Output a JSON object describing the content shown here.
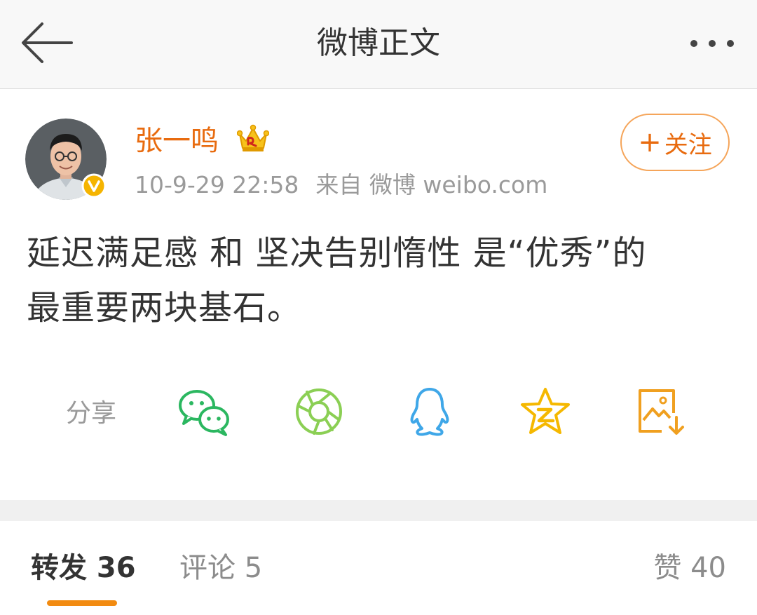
{
  "header": {
    "title": "微博正文",
    "back_icon": "arrow-left-icon",
    "more_icon": "more-dots-icon"
  },
  "post": {
    "author": "张一鸣",
    "author_badge_icon": "crown-icon",
    "verified_icon": "verified-v-icon",
    "timestamp": "10-9-29 22:58",
    "source": "来自 微博 weibo.com",
    "follow_label": "关注",
    "follow_plus": "+",
    "text": "延迟满足感 和 坚决告别惰性 是“优秀”的最重要两块基石。"
  },
  "share": {
    "label": "分享",
    "targets": [
      "wechat-icon",
      "moments-icon",
      "qq-icon",
      "qzone-icon",
      "save-image-icon"
    ]
  },
  "tabs": {
    "repost": "转发 36",
    "comment": "评论 5",
    "like": "赞 40"
  },
  "colors": {
    "accent": "#f28b11",
    "author": "#e86b0f",
    "wechat": "#2bb760",
    "moments": "#8bcf54",
    "qq": "#3fa7e8",
    "qzone": "#f5b800",
    "save": "#f0a020"
  }
}
